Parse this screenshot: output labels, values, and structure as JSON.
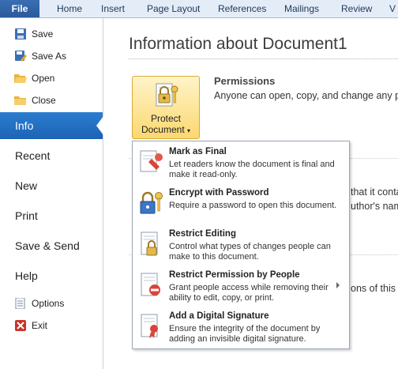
{
  "tabs": [
    {
      "label": "File"
    },
    {
      "label": "Home"
    },
    {
      "label": "Insert"
    },
    {
      "label": "Page Layout"
    },
    {
      "label": "References"
    },
    {
      "label": "Mailings"
    },
    {
      "label": "Review"
    },
    {
      "label": "V"
    }
  ],
  "nav": {
    "save": "Save",
    "save_as": "Save As",
    "open": "Open",
    "close": "Close",
    "info": "Info",
    "recent": "Recent",
    "new": "New",
    "print": "Print",
    "save_send": "Save & Send",
    "help": "Help",
    "options": "Options",
    "exit": "Exit"
  },
  "main": {
    "title": "Information about Document1",
    "protect_line1": "Protect",
    "protect_line2": "Document",
    "permissions_title": "Permissions",
    "permissions_desc": "Anyone can open, copy, and change any pa",
    "bg_line1": "that it conta",
    "bg_line2": "uthor's nam",
    "bg_line3": "ons of this fi"
  },
  "menu": {
    "items": [
      {
        "title": "Mark as Final",
        "desc": "Let readers know the document is final and make it read-only."
      },
      {
        "title": "Encrypt with Password",
        "desc": "Require a password to open this document."
      },
      {
        "title": "Restrict Editing",
        "desc": "Control what types of changes people can make to this document."
      },
      {
        "title": "Restrict Permission by People",
        "desc": "Grant people access while removing their ability to edit, copy, or print."
      },
      {
        "title": "Add a Digital Signature",
        "desc": "Ensure the integrity of the document by adding an invisible digital signature."
      }
    ]
  }
}
